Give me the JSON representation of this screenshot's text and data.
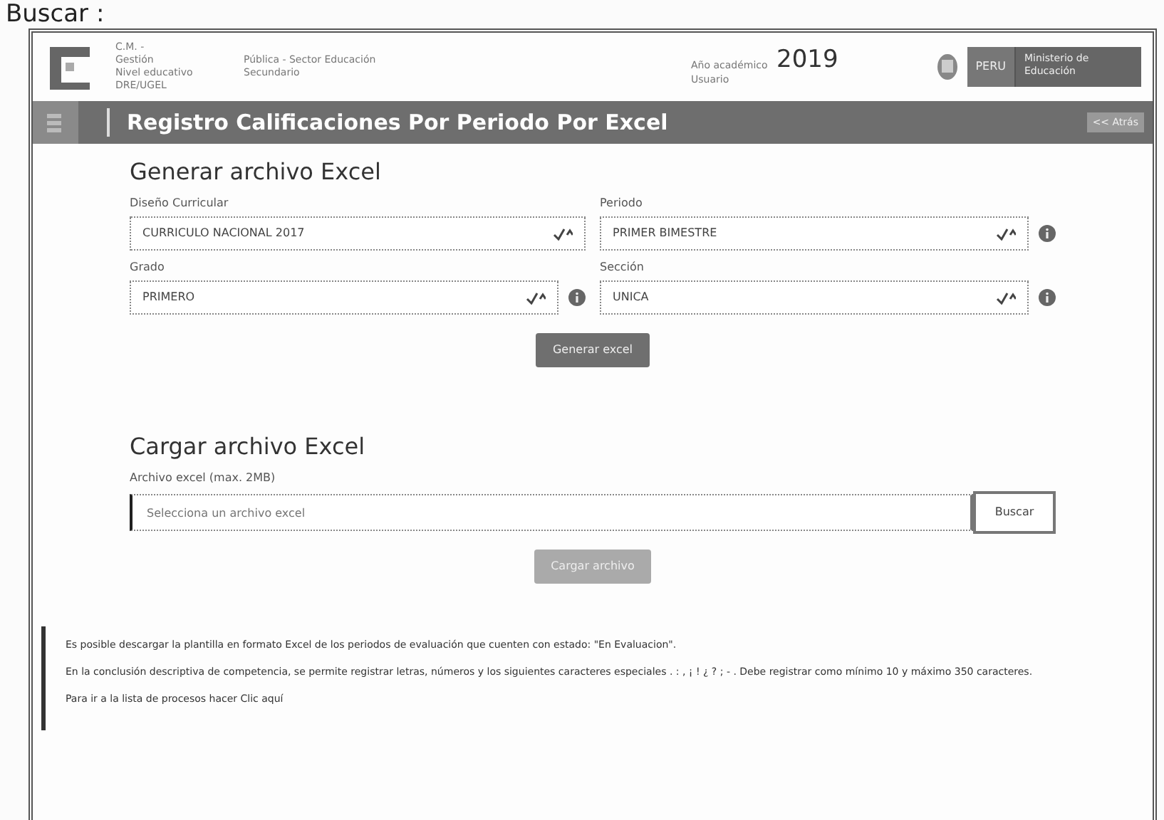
{
  "search_label": "Buscar :",
  "header": {
    "info": [
      {
        "label": "C.M. -"
      },
      {
        "label": "Gestión",
        "value": "Pública - Sector Educación"
      },
      {
        "label": "Nivel educativo",
        "value": "Secundario"
      },
      {
        "label": "DRE/UGEL"
      }
    ],
    "year_label": "Año académico",
    "year": "2019",
    "user_label": "Usuario",
    "country": "PERU",
    "ministry": "Ministerio de Educación"
  },
  "title_bar": {
    "title": "Registro Calificaciones Por Periodo Por Excel",
    "back": "<< Atrás"
  },
  "generate": {
    "heading": "Generar archivo Excel",
    "fields": [
      {
        "label": "Diseño Curricular",
        "value": "CURRICULO NACIONAL 2017",
        "info": false
      },
      {
        "label": "Periodo",
        "value": "PRIMER BIMESTRE",
        "info": true
      },
      {
        "label": "Grado",
        "value": "PRIMERO",
        "info": true
      },
      {
        "label": "Sección",
        "value": "UNICA",
        "info": true
      }
    ],
    "button": {
      "label": "Generar excel",
      "disabled": false
    }
  },
  "upload": {
    "heading": "Cargar archivo Excel",
    "label": "Archivo excel (max. 2MB)",
    "placeholder": "Selecciona un archivo excel",
    "browse": "Buscar",
    "button": {
      "label": "Cargar archivo",
      "disabled": true
    }
  },
  "notes": [
    {
      "text": "Es posible descargar la plantilla en formato Excel de los periodos de evaluación que cuenten con estado: \"En Evaluacion\"."
    },
    {
      "text": "En la conclusión descriptiva de competencia, se permite registrar letras, números y los siguientes caracteres especiales . : , ¡ ! ¿ ? ; - . Debe registrar como mínimo 10 y máximo 350 caracteres."
    },
    {
      "text": "Para ir a la lista de procesos hacer Clic",
      "link": "aquí"
    }
  ]
}
